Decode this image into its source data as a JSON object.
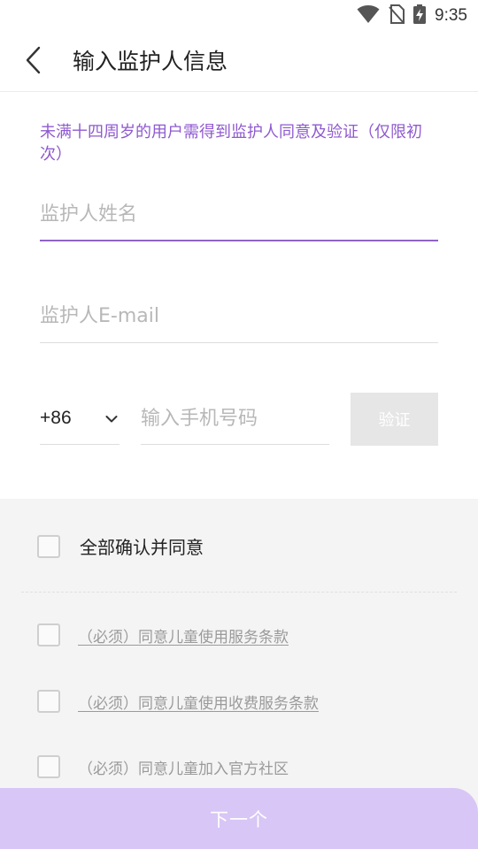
{
  "status_bar": {
    "time": "9:35"
  },
  "header": {
    "title": "输入监护人信息"
  },
  "form": {
    "notice": "未满十四周岁的用户需得到监护人同意及验证（仅限初次）",
    "guardian_name_placeholder": "监护人姓名",
    "guardian_email_placeholder": "监护人E-mail",
    "country_code": "+86",
    "phone_placeholder": "输入手机号码",
    "verify_label": "验证"
  },
  "agreements": {
    "all_label": "全部确认并同意",
    "items": [
      {
        "label": "（必须）同意儿童使用服务条款",
        "underline": true
      },
      {
        "label": "（必须）同意儿童使用收费服务条款",
        "underline": true
      },
      {
        "label": "（必须）同意儿童加入官方社区",
        "underline": false
      }
    ]
  },
  "footer": {
    "next_label": "下一个"
  },
  "colors": {
    "accent": "#9063c8",
    "notice_text": "#8f5ad0",
    "next_button": "#d8c6f6",
    "verify_button": "#e6e6e6",
    "panel_bg": "#f4f4f4"
  },
  "icons": {
    "back": "chevron-left-icon",
    "dropdown": "chevron-down-icon",
    "wifi": "wifi-icon",
    "no_sim": "no-sim-icon",
    "battery": "battery-charging-icon"
  }
}
